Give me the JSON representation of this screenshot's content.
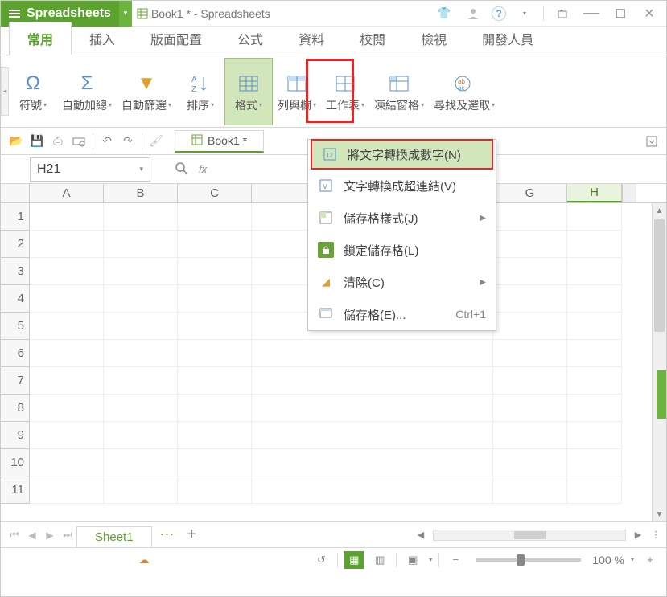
{
  "app": {
    "name": "Spreadsheets",
    "doc_title": "Book1 * - Spreadsheets"
  },
  "ribbon_tabs": {
    "t0": "常用",
    "t1": "插入",
    "t2": "版面配置",
    "t3": "公式",
    "t4": "資料",
    "t5": "校閱",
    "t6": "檢視",
    "t7": "開發人員"
  },
  "ribbon": {
    "symbol": "符號",
    "autosum": "自動加總",
    "autofilter": "自動篩選",
    "sort": "排序",
    "format": "格式",
    "rowcol": "列與欄",
    "worksheet": "工作表",
    "freeze": "凍結窗格",
    "find": "尋找及選取"
  },
  "qat_tab": "Book1 *",
  "namebox": "H21",
  "menu": {
    "m0": "將文字轉換成數字(N)",
    "m1": "文字轉換成超連結(V)",
    "m2": "儲存格樣式(J)",
    "m3": "鎖定儲存格(L)",
    "m4": "清除(C)",
    "m5": "儲存格(E)...",
    "m5_short": "Ctrl+1"
  },
  "columns": {
    "A": "A",
    "B": "B",
    "C": "C",
    "G": "G",
    "H": "H"
  },
  "rows": {
    "r1": "1",
    "r2": "2",
    "r3": "3",
    "r4": "4",
    "r5": "5",
    "r6": "6",
    "r7": "7",
    "r8": "8",
    "r9": "9",
    "r10": "10",
    "r11": "11"
  },
  "sheet_tab": "Sheet1",
  "status": {
    "zoom": "100 %",
    "minus": "−",
    "plus": "+"
  }
}
